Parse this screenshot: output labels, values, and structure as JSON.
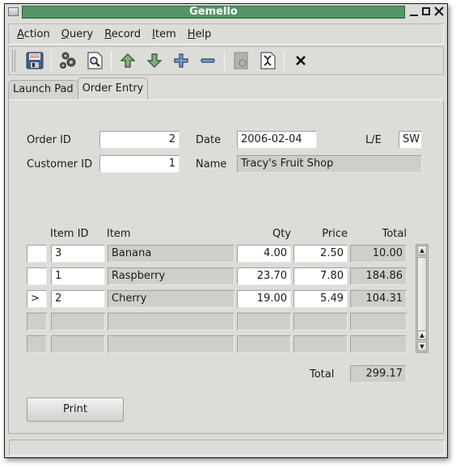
{
  "window": {
    "title": "Gemello",
    "controls": [
      "minimize",
      "maximize",
      "close"
    ]
  },
  "menubar": {
    "items": [
      {
        "label": "Action",
        "mnemonic": "A"
      },
      {
        "label": "Query",
        "mnemonic": "Q"
      },
      {
        "label": "Record",
        "mnemonic": "R"
      },
      {
        "label": "Item",
        "mnemonic": "I"
      },
      {
        "label": "Help",
        "mnemonic": "H"
      }
    ]
  },
  "toolbar": {
    "buttons": [
      {
        "icon": "save-icon",
        "tooltip": "Save"
      },
      {
        "icon": "gears-icon",
        "tooltip": "Execute"
      },
      {
        "icon": "find-icon",
        "tooltip": "Query"
      },
      {
        "icon": "arrow-up-icon",
        "tooltip": "Previous"
      },
      {
        "icon": "arrow-down-icon",
        "tooltip": "Next"
      },
      {
        "icon": "plus-icon",
        "tooltip": "Insert"
      },
      {
        "icon": "minus-icon",
        "tooltip": "Delete"
      },
      {
        "icon": "disabled-document-icon",
        "tooltip": ""
      },
      {
        "icon": "properties-document-icon",
        "tooltip": ""
      },
      {
        "icon": "close-x-icon",
        "tooltip": "Close"
      }
    ]
  },
  "tabs": [
    {
      "label": "Launch Pad",
      "active": false
    },
    {
      "label": "Order Entry",
      "active": true
    }
  ],
  "header": {
    "order_id_label": "Order ID",
    "order_id": "2",
    "date_label": "Date",
    "date": "2006-02-04",
    "le_label": "L/E",
    "le": "SW",
    "customer_id_label": "Customer ID",
    "customer_id": "1",
    "name_label": "Name",
    "name": "Tracy's Fruit Shop"
  },
  "lines": {
    "columns": [
      "Item ID",
      "Item",
      "Qty",
      "Price",
      "Total"
    ],
    "rows": [
      {
        "marker": "",
        "item_id": "3",
        "item": "Banana",
        "qty": "4.00",
        "price": "2.50",
        "total": "10.00"
      },
      {
        "marker": "",
        "item_id": "1",
        "item": "Raspberry",
        "qty": "23.70",
        "price": "7.80",
        "total": "184.86"
      },
      {
        "marker": ">",
        "item_id": "2",
        "item": "Cherry",
        "qty": "19.00",
        "price": "5.49",
        "total": "104.31"
      },
      {
        "marker": "",
        "item_id": "",
        "item": "",
        "qty": "",
        "price": "",
        "total": ""
      },
      {
        "marker": "",
        "item_id": "",
        "item": "",
        "qty": "",
        "price": "",
        "total": ""
      }
    ],
    "total_label": "Total",
    "grand_total": "299.17"
  },
  "actions": {
    "print_label": "Print"
  },
  "statusbar": {
    "text": ""
  }
}
